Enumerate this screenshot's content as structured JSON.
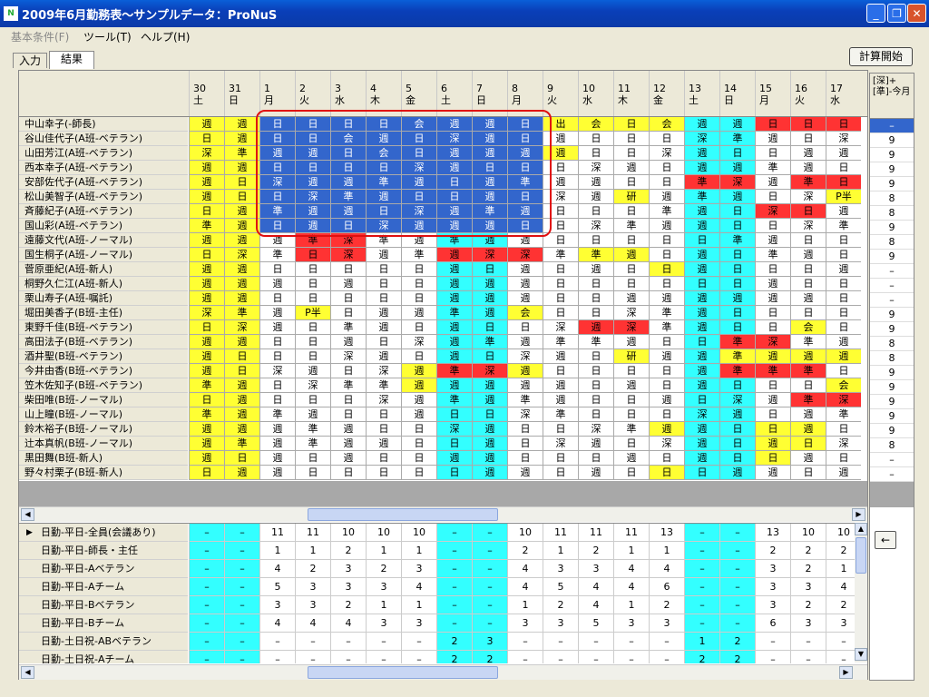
{
  "window": {
    "title": "2009年6月勤務表～サンプルデータ：ProNuS",
    "icon_text": "N"
  },
  "menu": [
    {
      "label": "基本条件(F)",
      "disabled": true
    },
    {
      "label": "ツール(T)",
      "disabled": false
    },
    {
      "label": "ヘルプ(H)",
      "disabled": false
    }
  ],
  "tabs": [
    {
      "label": "入力",
      "active": false
    },
    {
      "label": "結果",
      "active": true
    }
  ],
  "calc_button": "計算開始",
  "back_button": "←",
  "right_header": "[深]+[準]-今月",
  "days": [
    {
      "d": "30",
      "w": "土"
    },
    {
      "d": "31",
      "w": "日"
    },
    {
      "d": "1",
      "w": "月"
    },
    {
      "d": "2",
      "w": "火"
    },
    {
      "d": "3",
      "w": "水"
    },
    {
      "d": "4",
      "w": "木"
    },
    {
      "d": "5",
      "w": "金"
    },
    {
      "d": "6",
      "w": "土"
    },
    {
      "d": "7",
      "w": "日"
    },
    {
      "d": "8",
      "w": "月"
    },
    {
      "d": "9",
      "w": "火"
    },
    {
      "d": "10",
      "w": "水"
    },
    {
      "d": "11",
      "w": "木"
    },
    {
      "d": "12",
      "w": "金"
    },
    {
      "d": "13",
      "w": "土"
    },
    {
      "d": "14",
      "w": "日"
    },
    {
      "d": "15",
      "w": "月"
    },
    {
      "d": "16",
      "w": "火"
    },
    {
      "d": "17",
      "w": "水"
    }
  ],
  "staff": [
    {
      "name": "中山幸子(-師長)",
      "cells": [
        "週y",
        "週y",
        "日s",
        "日s",
        "日s",
        "日s",
        "会s",
        "週s",
        "週s",
        "日s",
        "出y",
        "会y",
        "日y",
        "会y",
        "週c",
        "週c",
        "日r",
        "日r",
        "日r"
      ],
      "right": "–",
      "right_sel": true
    },
    {
      "name": "谷山佳代子(A班-ベテラン)",
      "cells": [
        "日y",
        "週y",
        "日s",
        "日s",
        "会s",
        "週s",
        "日s",
        "深s",
        "週s",
        "日s",
        "週w",
        "日w",
        "日w",
        "日w",
        "深c",
        "準c",
        "週w",
        "日w",
        "深w"
      ],
      "right": "9"
    },
    {
      "name": "山田芳江(A班-ベテラン)",
      "cells": [
        "深y",
        "準y",
        "週s",
        "週s",
        "日s",
        "会s",
        "日s",
        "週s",
        "週s",
        "週s",
        "週y",
        "日w",
        "日w",
        "深w",
        "週c",
        "日c",
        "日w",
        "週w",
        "週w"
      ],
      "right": "9"
    },
    {
      "name": "西本幸子(A班-ベテラン)",
      "cells": [
        "週y",
        "週y",
        "日s",
        "日s",
        "日s",
        "日s",
        "深s",
        "週s",
        "日s",
        "日s",
        "日w",
        "深w",
        "週w",
        "日w",
        "週c",
        "週c",
        "準w",
        "週w",
        "日w"
      ],
      "right": "9"
    },
    {
      "name": "安部佐代子(A班-ベテラン)",
      "cells": [
        "週y",
        "日y",
        "深s",
        "週s",
        "週s",
        "準s",
        "週s",
        "日s",
        "週s",
        "準s",
        "週w",
        "週w",
        "日w",
        "日w",
        "準r",
        "深r",
        "週w",
        "準r",
        "日r"
      ],
      "right": "9"
    },
    {
      "name": "松山美智子(A班-ベテラン)",
      "cells": [
        "週y",
        "日y",
        "日s",
        "深s",
        "準s",
        "週s",
        "日s",
        "日s",
        "週s",
        "日s",
        "深w",
        "週w",
        "研y",
        "週w",
        "準c",
        "週c",
        "日w",
        "深w",
        "P半y"
      ],
      "right": "8"
    },
    {
      "name": "斉藤紀子(A班-ベテラン)",
      "cells": [
        "日y",
        "週y",
        "準s",
        "週s",
        "週s",
        "日s",
        "深s",
        "週s",
        "準s",
        "週s",
        "日w",
        "日w",
        "日w",
        "準w",
        "週c",
        "日c",
        "深r",
        "日r",
        "週w"
      ],
      "right": "8"
    },
    {
      "name": "国山彩(A班-ベテラン)",
      "cells": [
        "準y",
        "週y",
        "日s",
        "週s",
        "日s",
        "深s",
        "週s",
        "週s",
        "週s",
        "日s",
        "日w",
        "深w",
        "準w",
        "週w",
        "週c",
        "日c",
        "日w",
        "深w",
        "準w"
      ],
      "right": "9"
    },
    {
      "name": "遠藤文代(A班-ノーマル)",
      "cells": [
        "週y",
        "週y",
        "週w",
        "準r",
        "深r",
        "準w",
        "週w",
        "準c",
        "週c",
        "週w",
        "日w",
        "日w",
        "日w",
        "日w",
        "日c",
        "準c",
        "週w",
        "日w",
        "日w"
      ],
      "right": "8"
    },
    {
      "name": "国生桐子(A班-ノーマル)",
      "cells": [
        "日y",
        "深y",
        "準w",
        "日r",
        "深r",
        "週w",
        "準w",
        "週r",
        "深r",
        "深r",
        "準w",
        "準y",
        "週y",
        "日w",
        "週c",
        "日c",
        "準w",
        "週w",
        "日w"
      ],
      "right": "9"
    },
    {
      "name": "菅原亜紀(A班-新人)",
      "cells": [
        "週y",
        "週y",
        "日w",
        "日w",
        "日w",
        "日w",
        "日w",
        "週c",
        "日c",
        "週w",
        "日w",
        "週w",
        "日w",
        "日y",
        "週c",
        "日c",
        "日w",
        "日w",
        "週w"
      ],
      "right": "–"
    },
    {
      "name": "桐野久仁江(A班-新人)",
      "cells": [
        "週y",
        "週y",
        "週w",
        "日w",
        "週w",
        "日w",
        "日w",
        "週c",
        "週c",
        "週w",
        "日w",
        "日w",
        "日w",
        "日w",
        "日c",
        "日c",
        "週w",
        "日w",
        "日w"
      ],
      "right": "–"
    },
    {
      "name": "栗山寿子(A班-嘱託)",
      "cells": [
        "週y",
        "週y",
        "日w",
        "日w",
        "日w",
        "日w",
        "日w",
        "週c",
        "週c",
        "週w",
        "日w",
        "日w",
        "週w",
        "週w",
        "週c",
        "週c",
        "週w",
        "週w",
        "日w"
      ],
      "right": "–"
    },
    {
      "name": "堀田美香子(B班-主任)",
      "cells": [
        "深y",
        "準y",
        "週w",
        "P半y",
        "日w",
        "週w",
        "週w",
        "準c",
        "週c",
        "会y",
        "日w",
        "日w",
        "深w",
        "準w",
        "週c",
        "日c",
        "日w",
        "日w",
        "日w"
      ],
      "right": "9"
    },
    {
      "name": "東野千佳(B班-ベテラン)",
      "cells": [
        "日y",
        "深y",
        "週w",
        "日w",
        "準w",
        "週w",
        "日w",
        "週c",
        "日c",
        "日w",
        "深w",
        "週r",
        "深r",
        "準w",
        "週c",
        "日c",
        "日w",
        "会y",
        "日w"
      ],
      "right": "9"
    },
    {
      "name": "高田法子(B班-ベテラン)",
      "cells": [
        "週y",
        "週y",
        "日w",
        "日w",
        "週w",
        "日w",
        "深w",
        "週c",
        "準c",
        "週w",
        "準w",
        "準w",
        "週w",
        "日w",
        "日c",
        "準r",
        "深r",
        "準w",
        "週w"
      ],
      "right": "8"
    },
    {
      "name": "酒井聖(B班-ベテラン)",
      "cells": [
        "週y",
        "日y",
        "日w",
        "日w",
        "深w",
        "週w",
        "日w",
        "週c",
        "日c",
        "深w",
        "週w",
        "日w",
        "研y",
        "週w",
        "週c",
        "準y",
        "週y",
        "週y",
        "週y"
      ],
      "right": "8"
    },
    {
      "name": "今井由香(B班-ベテラン)",
      "cells": [
        "週y",
        "日y",
        "深w",
        "週w",
        "日w",
        "深w",
        "週y",
        "準r",
        "深r",
        "週y",
        "日w",
        "日w",
        "日w",
        "日w",
        "週c",
        "準r",
        "準r",
        "準r",
        "日w"
      ],
      "right": "9"
    },
    {
      "name": "笠木佐知子(B班-ベテラン)",
      "cells": [
        "準y",
        "週y",
        "日w",
        "深w",
        "準w",
        "準w",
        "週y",
        "週c",
        "週c",
        "週w",
        "週w",
        "日w",
        "週w",
        "日w",
        "週c",
        "日c",
        "日w",
        "日w",
        "会y"
      ],
      "right": "9"
    },
    {
      "name": "柴田唯(B班-ノーマル)",
      "cells": [
        "日y",
        "週y",
        "日w",
        "日w",
        "日w",
        "深w",
        "週w",
        "準c",
        "週c",
        "準w",
        "週w",
        "日w",
        "日w",
        "週w",
        "日c",
        "深c",
        "週w",
        "準r",
        "深r"
      ],
      "right": "9"
    },
    {
      "name": "山上瞳(B班-ノーマル)",
      "cells": [
        "準y",
        "週y",
        "準w",
        "週w",
        "日w",
        "日w",
        "週w",
        "日c",
        "日c",
        "深w",
        "準w",
        "日w",
        "日w",
        "日w",
        "深c",
        "週c",
        "日w",
        "週w",
        "準w"
      ],
      "right": "9"
    },
    {
      "name": "鈴木裕子(B班-ノーマル)",
      "cells": [
        "週y",
        "週y",
        "週w",
        "準w",
        "週w",
        "日w",
        "日w",
        "深c",
        "週c",
        "日w",
        "日w",
        "深w",
        "準w",
        "週y",
        "週c",
        "日c",
        "日y",
        "週y",
        "日w"
      ],
      "right": "9"
    },
    {
      "name": "辻本真帆(B班-ノーマル)",
      "cells": [
        "週y",
        "準y",
        "週w",
        "準w",
        "週w",
        "週w",
        "日w",
        "日c",
        "週c",
        "日w",
        "深w",
        "週w",
        "日w",
        "深w",
        "週c",
        "日c",
        "週y",
        "日y",
        "深w"
      ],
      "right": "8"
    },
    {
      "name": "黒田舞(B班-新人)",
      "cells": [
        "週y",
        "日y",
        "週w",
        "日w",
        "週w",
        "日w",
        "日w",
        "週c",
        "週c",
        "日w",
        "日w",
        "日w",
        "週w",
        "日w",
        "週c",
        "日c",
        "日y",
        "週w",
        "日w"
      ],
      "right": "–"
    },
    {
      "name": "野々村栗子(B班-新人)",
      "cells": [
        "日y",
        "週y",
        "週w",
        "日w",
        "日w",
        "日w",
        "日w",
        "日c",
        "週c",
        "週w",
        "日w",
        "週w",
        "日w",
        "日y",
        "日c",
        "週c",
        "週w",
        "日w",
        "週w"
      ],
      "right": "–"
    }
  ],
  "summary": [
    {
      "name": "日勤-平日-全員(会議あり)",
      "current": true,
      "cells": [
        "–",
        "–",
        "11",
        "11",
        "10",
        "10",
        "10",
        "–",
        "–",
        "10",
        "11",
        "11",
        "11",
        "13",
        "–",
        "–",
        "13",
        "10",
        "10"
      ]
    },
    {
      "name": "日勤-平日-師長・主任",
      "cells": [
        "–",
        "–",
        "1",
        "1",
        "2",
        "1",
        "1",
        "–",
        "–",
        "2",
        "1",
        "2",
        "1",
        "1",
        "–",
        "–",
        "2",
        "2",
        "2"
      ]
    },
    {
      "name": "日勤-平日-Aベテラン",
      "cells": [
        "–",
        "–",
        "4",
        "2",
        "3",
        "2",
        "3",
        "–",
        "–",
        "4",
        "3",
        "3",
        "4",
        "4",
        "–",
        "–",
        "3",
        "2",
        "1"
      ]
    },
    {
      "name": "日勤-平日-Aチーム",
      "cells": [
        "–",
        "–",
        "5",
        "3",
        "3",
        "3",
        "4",
        "–",
        "–",
        "4",
        "5",
        "4",
        "4",
        "6",
        "–",
        "–",
        "3",
        "3",
        "4"
      ]
    },
    {
      "name": "日勤-平日-Bベテラン",
      "cells": [
        "–",
        "–",
        "3",
        "3",
        "2",
        "1",
        "1",
        "–",
        "–",
        "1",
        "2",
        "4",
        "1",
        "2",
        "–",
        "–",
        "3",
        "2",
        "2"
      ]
    },
    {
      "name": "日勤-平日-Bチーム",
      "cells": [
        "–",
        "–",
        "4",
        "4",
        "4",
        "3",
        "3",
        "–",
        "–",
        "3",
        "3",
        "5",
        "3",
        "3",
        "–",
        "–",
        "6",
        "3",
        "3"
      ]
    },
    {
      "name": "日勤-土日祝-ABベテラン",
      "cells": [
        "–",
        "–",
        "–",
        "–",
        "–",
        "–",
        "–",
        "2",
        "3",
        "–",
        "–",
        "–",
        "–",
        "–",
        "1",
        "2",
        "–",
        "–",
        "–"
      ]
    },
    {
      "name": "日勤-土日祝-Aチーム",
      "cells": [
        "–",
        "–",
        "–",
        "–",
        "–",
        "–",
        "–",
        "2",
        "2",
        "–",
        "–",
        "–",
        "–",
        "–",
        "2",
        "2",
        "–",
        "–",
        "–"
      ]
    }
  ]
}
